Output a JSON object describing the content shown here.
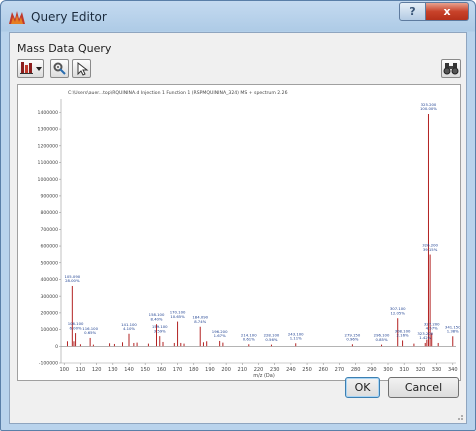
{
  "window": {
    "title": "Query Editor",
    "help_label": "?",
    "close_label": "x"
  },
  "section": {
    "label": "Mass Data Query"
  },
  "toolbar": {
    "buttons": [
      {
        "icon": "filter-dropdown-icon"
      },
      {
        "icon": "gear-pointer-icon"
      },
      {
        "icon": "select-arrow-icon"
      },
      {
        "icon": "binoculars-icon"
      }
    ]
  },
  "footer": {
    "ok_label": "OK",
    "cancel_label": "Cancel"
  },
  "chart_data": {
    "type": "bar",
    "title": "C:\\Users\\auer...top\\RQUININA.d Injection 1 Function 1 (RSPMQUININA_324) MS + spectrum 2.26",
    "xlabel": "m/z (Da)",
    "ylabel": "",
    "xlim": [
      98,
      342
    ],
    "ylim": [
      -100000,
      1480000
    ],
    "grid": false,
    "x_ticks": [
      100,
      110,
      120,
      130,
      140,
      150,
      160,
      170,
      180,
      190,
      200,
      210,
      220,
      230,
      240,
      250,
      260,
      270,
      280,
      290,
      300,
      310,
      320,
      330,
      340
    ],
    "y_ticks": [
      -100000,
      0,
      100000,
      200000,
      300000,
      400000,
      500000,
      600000,
      700000,
      800000,
      900000,
      1000000,
      1100000,
      1200000,
      1300000,
      1400000
    ],
    "bar_color": "#b22222",
    "peaks": [
      {
        "mz": 102,
        "intensity": 30000
      },
      {
        "mz": 105,
        "intensity": 361000,
        "label": "105.090\n28.00%"
      },
      {
        "mz": 106,
        "intensity": 30000
      },
      {
        "mz": 107,
        "intensity": 79000,
        "label": "106.100\n6.00%"
      },
      {
        "mz": 110,
        "intensity": 12000
      },
      {
        "mz": 116,
        "intensity": 50000,
        "label": "116.100\n0.65%"
      },
      {
        "mz": 118,
        "intensity": 10000
      },
      {
        "mz": 128,
        "intensity": 18000
      },
      {
        "mz": 131,
        "intensity": 14000
      },
      {
        "mz": 136,
        "intensity": 24000
      },
      {
        "mz": 140,
        "intensity": 75000,
        "label": "141.100\n4.10%"
      },
      {
        "mz": 143,
        "intensity": 20000
      },
      {
        "mz": 145,
        "intensity": 22000
      },
      {
        "mz": 152,
        "intensity": 16000
      },
      {
        "mz": 157,
        "intensity": 132000,
        "label": "158.100\n8.40%"
      },
      {
        "mz": 159,
        "intensity": 61000,
        "label": "159.100\n3.59%"
      },
      {
        "mz": 161,
        "intensity": 26000
      },
      {
        "mz": 168,
        "intensity": 20000
      },
      {
        "mz": 170,
        "intensity": 148000,
        "label": "170.100\n10.65%"
      },
      {
        "mz": 172,
        "intensity": 20000
      },
      {
        "mz": 174,
        "intensity": 16000
      },
      {
        "mz": 184,
        "intensity": 117000,
        "label": "184.090\n8.74%"
      },
      {
        "mz": 186,
        "intensity": 24000
      },
      {
        "mz": 188,
        "intensity": 30000
      },
      {
        "mz": 196,
        "intensity": 32000,
        "label": "196.200\n1.67%"
      },
      {
        "mz": 198,
        "intensity": 22000
      },
      {
        "mz": 214,
        "intensity": 12000,
        "label": "214.100\n0.61%"
      },
      {
        "mz": 228,
        "intensity": 10000,
        "label": "228.100\n0.56%"
      },
      {
        "mz": 243,
        "intensity": 18000,
        "label": "243.100\n1.11%"
      },
      {
        "mz": 278,
        "intensity": 12000,
        "label": "279.150\n0.96%"
      },
      {
        "mz": 296,
        "intensity": 10000,
        "label": "296.100\n0.85%"
      },
      {
        "mz": 306,
        "intensity": 168000,
        "label": "307.100\n12.05%"
      },
      {
        "mz": 309,
        "intensity": 35000,
        "label": "308.100\n2.16%"
      },
      {
        "mz": 316,
        "intensity": 16000
      },
      {
        "mz": 323,
        "intensity": 20000,
        "label": "323.200\n1.42%"
      },
      {
        "mz": 324,
        "intensity": 40000
      },
      {
        "mz": 325,
        "intensity": 1390000,
        "label": "325.200\n100.00%"
      },
      {
        "mz": 326,
        "intensity": 549000,
        "label": "326.200\n39.15%"
      },
      {
        "mz": 327,
        "intensity": 78000,
        "label": "327.200\n4.57%"
      },
      {
        "mz": 331,
        "intensity": 20000
      },
      {
        "mz": 340,
        "intensity": 60000,
        "label": "341.150\n1.38%"
      }
    ]
  }
}
